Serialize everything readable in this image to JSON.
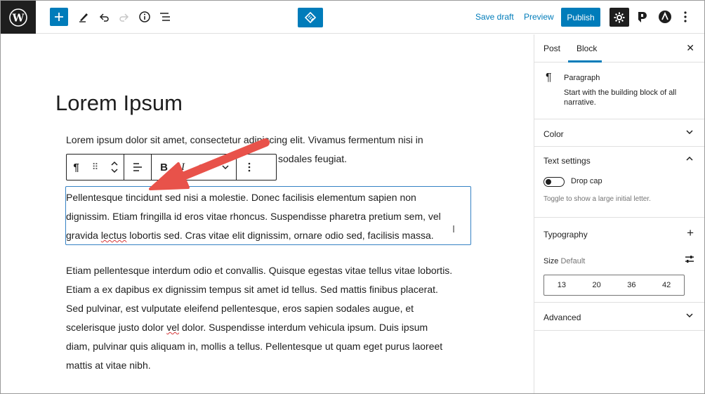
{
  "topbar": {
    "save_draft": "Save draft",
    "preview": "Preview",
    "publish": "Publish",
    "icons": [
      "wordpress-logo-icon",
      "plus-icon",
      "pencil-icon",
      "undo-icon",
      "redo-icon",
      "info-icon",
      "list-view-icon",
      "patterns-icon",
      "gear-icon",
      "plugin-p-icon",
      "plugin-a-icon",
      "more-vertical-icon"
    ],
    "accent": "#007cba"
  },
  "editor": {
    "title": "Lorem Ipsum",
    "para1_line1": "Lorem ipsum dolor sit amet, consectetur adipiscing elit. Vivamus fermentum nisi in",
    "para1_line2": "sodales feugiat.",
    "para2_line1": "Pellentesque tincidunt sed nisi a molestie. Donec facilisis elementum sapien non",
    "para2_line2": "dignissim. Etiam fringilla id eros vitae rhoncus. Suspendisse pharetra pretium sem, vel",
    "para2_line3_a": "gravida ",
    "para2_line3_b": "lectus",
    "para2_line3_c": " lobortis sed. Cras vitae elit dignissim, ornare odio sed, facilisis massa.",
    "para3_line1": "Etiam pellentesque interdum odio et convallis. Quisque egestas vitae tellus vitae lobortis.",
    "para3_line2": "Etiam a ex dapibus ex dignissim tempus sit amet id tellus. Sed mattis finibus placerat.",
    "para3_line3": "Sed pulvinar, est vulputate eleifend pellentesque, eros sapien sodales augue, et",
    "para3_line4_a": "scelerisque justo dolor ",
    "para3_line4_b": "vel",
    "para3_line4_c": " dolor. Suspendisse interdum vehicula ipsum. Duis ipsum",
    "para3_line5": "diam, pulvinar quis aliquam in, mollis a tellus. Pellentesque ut quam eget purus laoreet",
    "para3_line6": "mattis at vitae nibh."
  },
  "block_toolbar": {
    "paragraph_glyph": "¶",
    "drag_glyph": "⠿",
    "bold": "B",
    "italic": "I"
  },
  "sidebar": {
    "tabs": [
      "Post",
      "Block"
    ],
    "active_tab": "Block",
    "block_name": "Paragraph",
    "block_description": "Start with the building block of all narrative.",
    "panels": {
      "color": "Color",
      "text_settings": "Text settings",
      "drop_cap_label": "Drop cap",
      "drop_cap_help": "Toggle to show a large initial letter.",
      "typography": "Typography",
      "size_label": "Size",
      "size_default": "Default",
      "sizes": [
        "13",
        "20",
        "36",
        "42"
      ],
      "advanced": "Advanced"
    }
  }
}
